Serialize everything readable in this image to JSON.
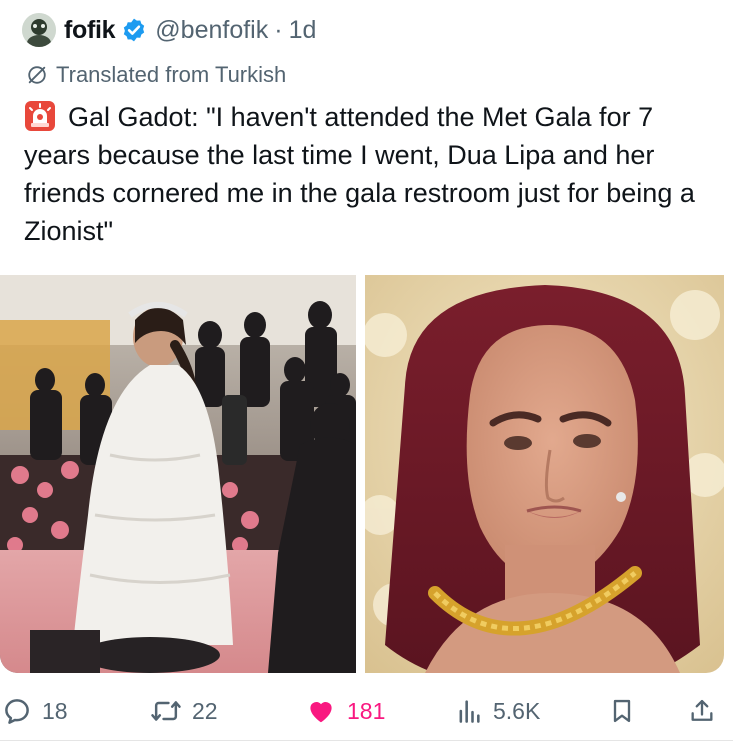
{
  "tweet": {
    "display_name": "fofik",
    "handle": "@benfofik",
    "separator": "·",
    "time": "1d",
    "translated_label": "Translated from Turkish",
    "text": "Gal Gadot: \"I haven't attended the Met Gala for 7 years because the last time I went, Dua Lipa and her friends cornered me in the gala restroom just for being a Zionist\""
  },
  "actions": {
    "replies": "18",
    "reposts": "22",
    "likes": "181",
    "views": "5.6K"
  },
  "icons": {
    "verified": "verified-badge-icon",
    "translate": "globe-slash-icon",
    "siren": "siren-emoji-icon",
    "reply": "reply-icon",
    "repost": "repost-icon",
    "like": "heart-icon",
    "views": "views-icon",
    "bookmark": "bookmark-icon",
    "share": "share-icon"
  },
  "colors": {
    "text": "#0f1419",
    "secondary": "#536471",
    "verified": "#1d9bf0",
    "like": "#f91880"
  }
}
